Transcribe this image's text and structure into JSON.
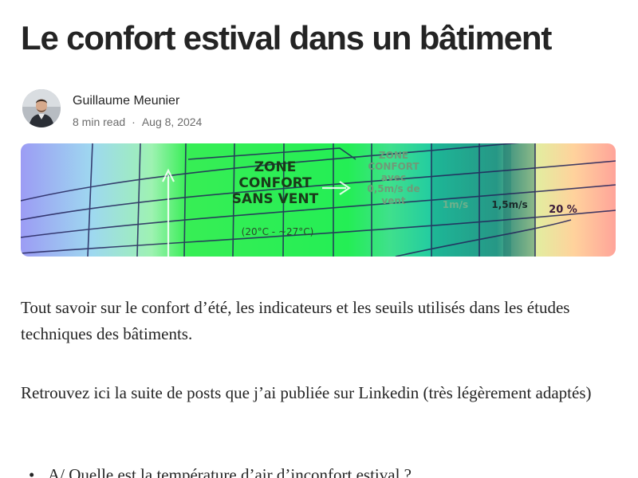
{
  "article": {
    "title": "Le confort estival dans un bâtiment",
    "author": "Guillaume Meunier",
    "read_time": "8 min read",
    "separator": "·",
    "date": "Aug 8, 2024"
  },
  "hero": {
    "zone_sans_vent": "ZONE\nCONFORT\nSANS VENT",
    "temp_range": "(20°C - ~27°C)",
    "zone_avec_vent": "ZONE\nCONFORT\navec\n0,5m/s de\nvent",
    "wind_1": "1m/s",
    "wind_15": "1,5m/s",
    "humidity_20": "20 %"
  },
  "body": {
    "para1": "Tout savoir sur le confort d’été, les indicateurs et les seuils utilisés dans les études techniques des bâtiments.",
    "para2": "Retrouvez ici la suite de posts que j’ai publiée sur Linkedin (très légèrement adaptés)",
    "list_items": [
      "A/ Quelle est la température d’air d’inconfort estival ?"
    ]
  }
}
